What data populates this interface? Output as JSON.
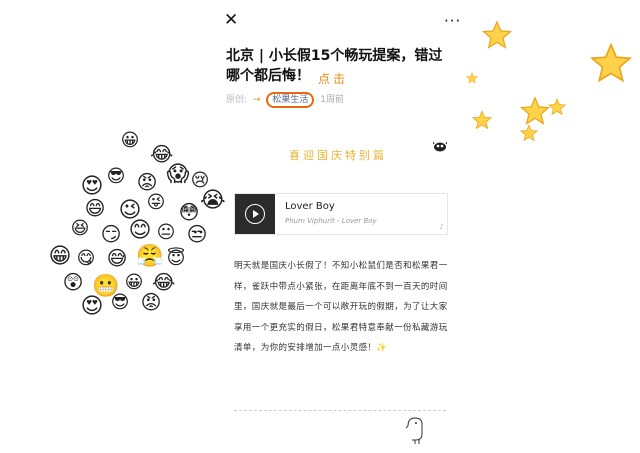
{
  "toolbar": {
    "close_glyph": "✕",
    "more_glyph": "···"
  },
  "article": {
    "title": "北京 | 小长假15个畅玩提案，错过哪个都后悔！",
    "annotation": "点击",
    "origin_label": "原创:",
    "author": "松果生活",
    "time": "1周前",
    "special_heading": "喜迎国庆特别篇",
    "music": {
      "song": "Lover Boy",
      "artist": "Phum Viphurit - Lover Boy"
    },
    "paragraph": "明天就是国庆小长假了！不知小松鼠们是否和松果君一样，雀跃中带点小紧张，在距离年底不到一百天的时间里，国庆就是最后一个可以敞开玩的假期，为了让大家享用一个更充实的假日，松果君特意奉献一份私藏游玩清单，为你的安排增加一点小灵感！✨"
  },
  "icons": [
    "close-icon",
    "more-icon",
    "arrow-icon",
    "cow-icon",
    "play-icon",
    "emoji-cluster",
    "star-icon"
  ],
  "colors": {
    "accent": "#e88a1a",
    "annotation_ring": "#e86a10",
    "heading": "#e8b52f",
    "link": "#576b95"
  }
}
